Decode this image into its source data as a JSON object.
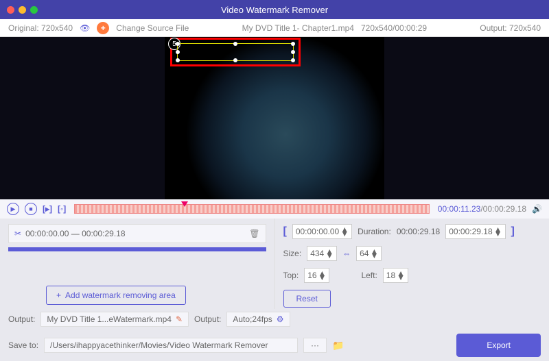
{
  "title": "Video Watermark Remover",
  "top": {
    "original": "Original: 720x540",
    "change": "Change Source File",
    "file": "My DVD Title 1- Chapter1.mp4",
    "meta": "720x540/00:00:29",
    "output": "Output: 720x540"
  },
  "badge": "5",
  "time": {
    "cur": "00:00:11.23",
    "dur": "/00:00:29.18"
  },
  "clip": {
    "range": "00:00:00.00 — 00:00:29.18"
  },
  "addArea": "Add watermark removing area",
  "range": {
    "start": "00:00:00.00",
    "durLabel": "Duration:",
    "durVal": "00:00:29.18",
    "end": "00:00:29.18"
  },
  "size": {
    "label": "Size:",
    "w": "434",
    "h": "64"
  },
  "pos": {
    "topL": "Top:",
    "top": "16",
    "leftL": "Left:",
    "left": "18"
  },
  "reset": "Reset",
  "out": {
    "label": "Output:",
    "file": "My DVD Title 1...eWatermark.mp4",
    "label2": "Output:",
    "fmt": "Auto;24fps"
  },
  "save": {
    "label": "Save to:",
    "path": "/Users/ihappyacethinker/Movies/Video Watermark Remover"
  },
  "export": "Export"
}
